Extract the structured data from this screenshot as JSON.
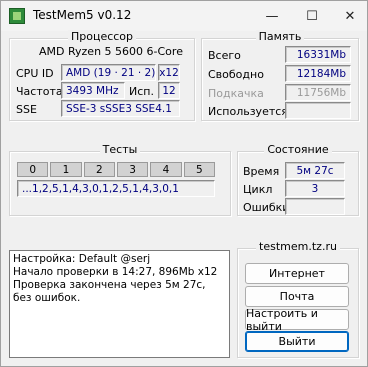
{
  "window": {
    "title": "TestMem5 v0.12",
    "minimize_glyph": "—",
    "maximize_glyph": "☐",
    "close_glyph": "✕"
  },
  "processor": {
    "title": "Процессор",
    "name": "AMD Ryzen 5 5600 6-Core",
    "cpu_id_label": "CPU ID",
    "cpu_id_value": "AMD  (19 · 21 · 2)",
    "threads_value": "x12",
    "freq_label": "Частота",
    "freq_value": "3493 MHz",
    "used_label": "Исп.",
    "used_value": "12",
    "sse_label": "SSE",
    "sse_value": "SSE-3 sSSE3 SSE4.1"
  },
  "memory": {
    "title": "Память",
    "total_label": "Всего",
    "total_value": "16331Mb",
    "free_label": "Свободно",
    "free_value": "12184Mb",
    "swap_label": "Подкачка",
    "swap_value": "11756Mb",
    "inuse_label": "Используется",
    "inuse_value": ""
  },
  "tests": {
    "title": "Тесты",
    "cells": [
      "0",
      "1",
      "2",
      "3",
      "4",
      "5"
    ],
    "sequence": "...1,2,5,1,4,3,0,1,2,5,1,4,3,0,1"
  },
  "status": {
    "title": "Состояние",
    "time_label": "Время",
    "time_value": "5м 27с",
    "cycle_label": "Цикл",
    "cycle_value": "3",
    "errors_label": "Ошибки",
    "errors_value": ""
  },
  "log": {
    "lines": [
      "Настройка: Default @serj",
      "Начало проверки в 14:27, 896Mb x12",
      "Проверка закончена через 5м 27с,",
      "без ошибок."
    ]
  },
  "links": {
    "site": "testmem.tz.ru",
    "internet_button": "Интернет",
    "mail_button": "Почта",
    "configure_exit_button": "Настроить и выйти",
    "exit_button": "Выйти"
  },
  "colors": {
    "value_text": "#000080",
    "accent": "#0067c0",
    "icon": "#2e8b3a"
  }
}
